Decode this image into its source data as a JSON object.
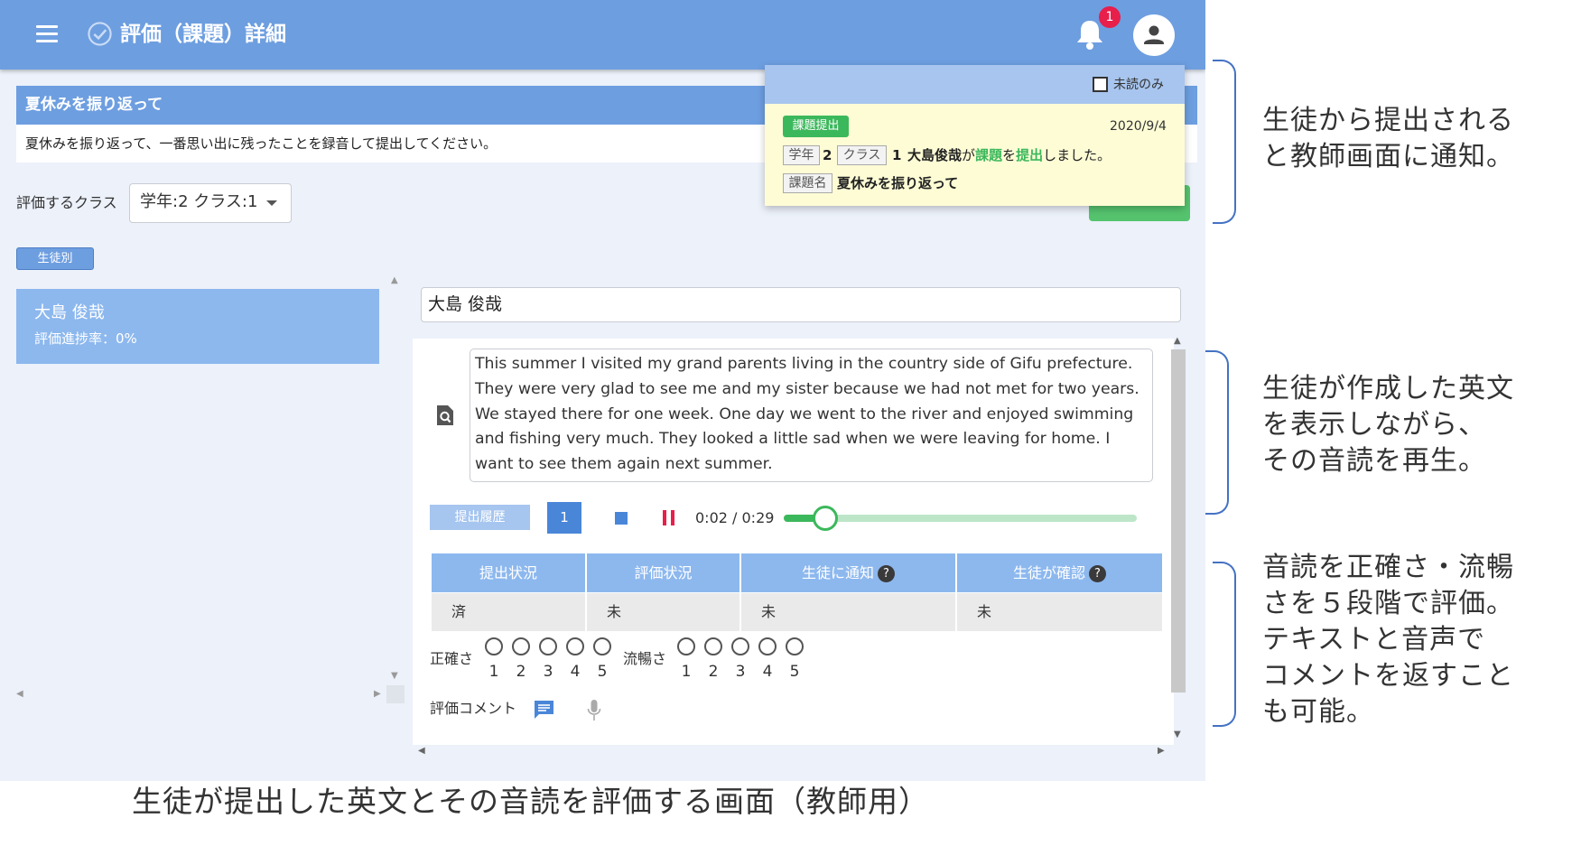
{
  "header": {
    "title": "評価（課題）詳細",
    "notification_count": "1"
  },
  "assignment": {
    "title": "夏休みを振り返って",
    "description": "夏休みを振り返って、一番思い出に残ったことを録音して提出してください。"
  },
  "class_filter": {
    "label": "評価するクラス",
    "value": "学年:2 クラス:1"
  },
  "view_tab": "生徒別",
  "student_list": [
    {
      "name": "大島 俊哉",
      "progress": "評価進捗率：0%"
    }
  ],
  "detail": {
    "student_name": "大島 俊哉",
    "essay": "This summer I visited my grand parents living in the country side of Gifu prefecture. They were very glad to see me and my sister because we had not met for two years. We stayed there for one week. One day we went to the river and enjoyed swimming and fishing very much. They looked a little sad when we were leaving for home. I want to see them again next summer.",
    "history_button": "提出履歴",
    "version": "1",
    "time": "0:02 / 0:29",
    "playback_fraction": 0.07,
    "status_headers": [
      "提出状況",
      "評価状況",
      "生徒に通知",
      "生徒が確認"
    ],
    "status_values": [
      "済",
      "未",
      "未",
      "未"
    ],
    "help_glyph": "?",
    "accuracy_label": "正確さ",
    "fluency_label": "流暢さ",
    "scale": [
      "1",
      "2",
      "3",
      "4",
      "5"
    ],
    "comment_label": "評価コメント"
  },
  "notification": {
    "unread_only": "未読のみ",
    "badge": "課題提出",
    "date": "2020/9/4",
    "grade_tag": "学年",
    "grade": "2",
    "class_tag": "クラス",
    "class": "1",
    "student": "大島俊哉",
    "msg_ga": "が",
    "msg_assignment": "課題",
    "msg_wo": "を",
    "msg_submit": "提出",
    "msg_end": "しました。",
    "name_tag": "課題名",
    "assignment_name": "夏休みを振り返って"
  },
  "annotations": {
    "a1": [
      "生徒から提出される",
      "と教師画面に通知。"
    ],
    "a2": [
      "生徒が作成した英文",
      "を表示しながら、",
      "その音読を再生。"
    ],
    "a3": [
      "音読を正確さ・流暢",
      "さを５段階で評価。",
      "テキストと音声で",
      "コメントを返すこと",
      "も可能。"
    ]
  },
  "caption": "生徒が提出した英文とその音読を評価する画面（教師用）",
  "colors": {
    "primary": "#6d9ee0",
    "accent_green": "#3cb85c",
    "badge_red": "#e81e4b"
  }
}
